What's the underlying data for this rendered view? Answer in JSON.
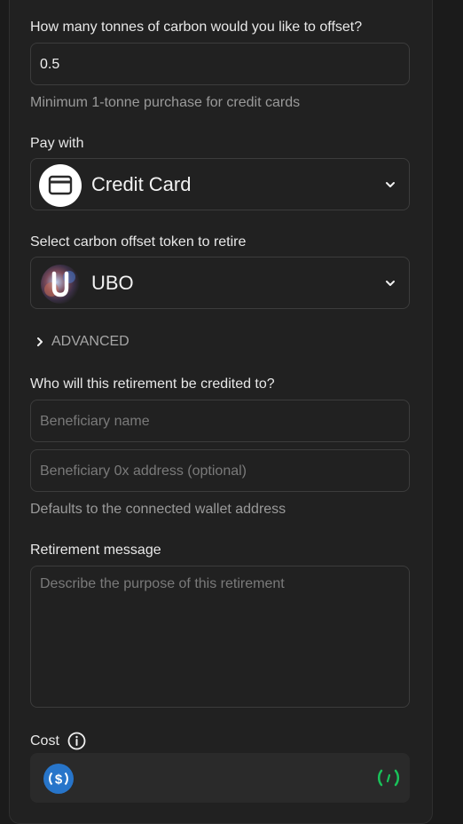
{
  "offset": {
    "question": "How many tonnes of carbon would you like to offset?",
    "quantity_value": "0.5",
    "minimum_hint": "Minimum 1-tonne purchase for credit cards"
  },
  "payment": {
    "label": "Pay with",
    "selected": "Credit Card",
    "icon": "credit-card-icon"
  },
  "token": {
    "label": "Select carbon offset token to retire",
    "selected": "UBO",
    "icon": "ubo-token-icon"
  },
  "advanced": {
    "label": "ADVANCED"
  },
  "beneficiary": {
    "label": "Who will this retirement be credited to?",
    "name_placeholder": "Beneficiary name",
    "address_placeholder": "Beneficiary 0x address (optional)",
    "hint": "Defaults to the connected wallet address"
  },
  "retirement_message": {
    "label": "Retirement message",
    "placeholder": "Describe the purpose of this retirement"
  },
  "cost": {
    "label": "Cost",
    "currency_icon": "usdc-icon",
    "loading_icon": "loading-spinner-icon"
  },
  "colors": {
    "background": "#212121",
    "border": "#3c3c3c",
    "usdc_blue": "#2775ca",
    "spinner_green": "#19c25a"
  }
}
